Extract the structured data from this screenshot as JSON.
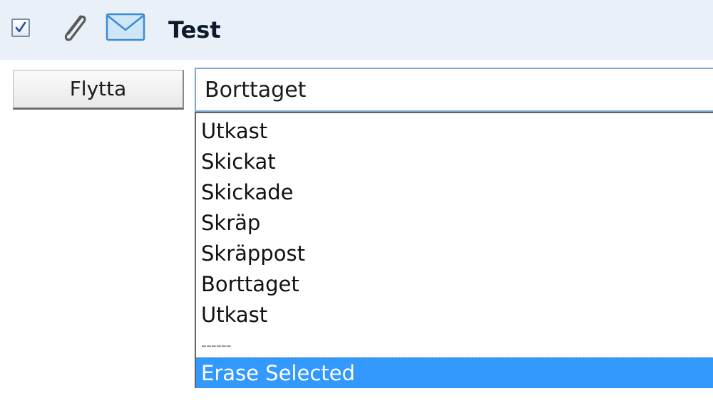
{
  "header": {
    "title": "Test",
    "checkbox_checked": true,
    "icons": [
      "checkbox-icon",
      "paperclip-icon",
      "envelope-icon"
    ]
  },
  "move_button": {
    "label": "Flytta"
  },
  "folder_select": {
    "value": "Borttaget",
    "options": [
      "Utkast",
      "Skickat",
      "Skickade",
      "Skräp",
      "Skräppost",
      "Borttaget",
      "Utkast",
      "------",
      "Erase Selected"
    ],
    "highlighted_option": "Erase Selected"
  },
  "colors": {
    "header_background": "#e9f0f7",
    "selection": "#3399ff",
    "focus_border": "#7fa6d8"
  }
}
